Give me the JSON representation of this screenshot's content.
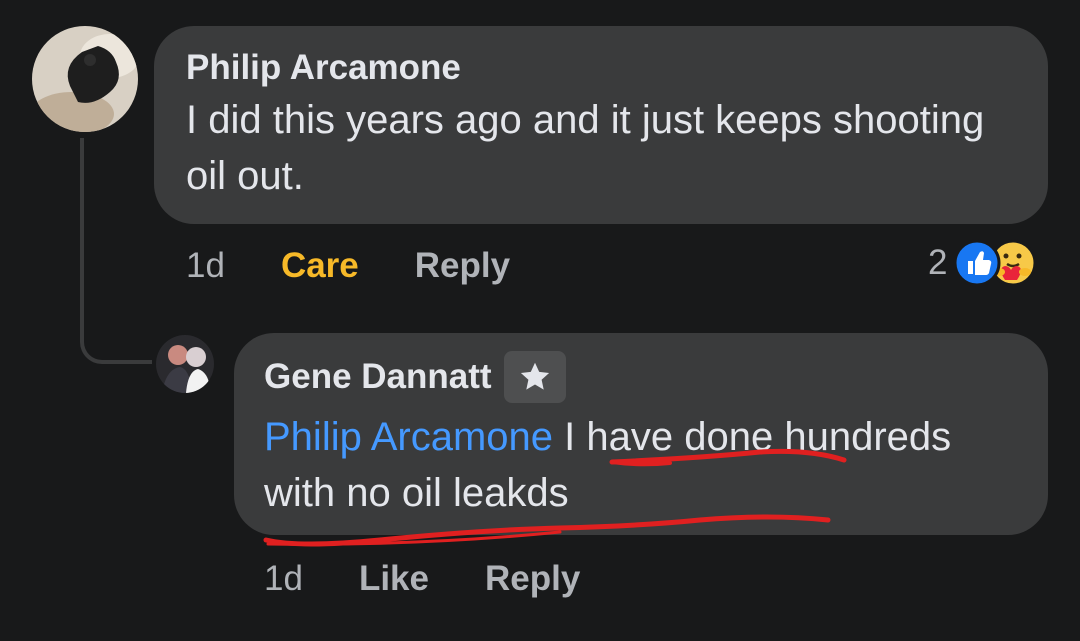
{
  "comments": [
    {
      "author": "Philip Arcamone",
      "text": "I did this years ago and it just keeps shooting oil out.",
      "time": "1d",
      "action_reaction": "Care",
      "action_reply": "Reply",
      "reaction_count": "2",
      "reaction_icons": [
        "like-icon",
        "care-icon"
      ]
    },
    {
      "author": "Gene Dannatt",
      "badge_icon": "star-icon",
      "mention": "Philip Arcamone",
      "text": " I have done hundreds with no oil leakds",
      "time": "1d",
      "action_like": "Like",
      "action_reply": "Reply"
    }
  ],
  "colors": {
    "background": "#18191a",
    "bubble": "#3a3b3c",
    "text": "#e4e6eb",
    "secondary_text": "#b0b3b8",
    "mention": "#4599ff",
    "care": "#f7b928",
    "annotation": "#e02020"
  }
}
